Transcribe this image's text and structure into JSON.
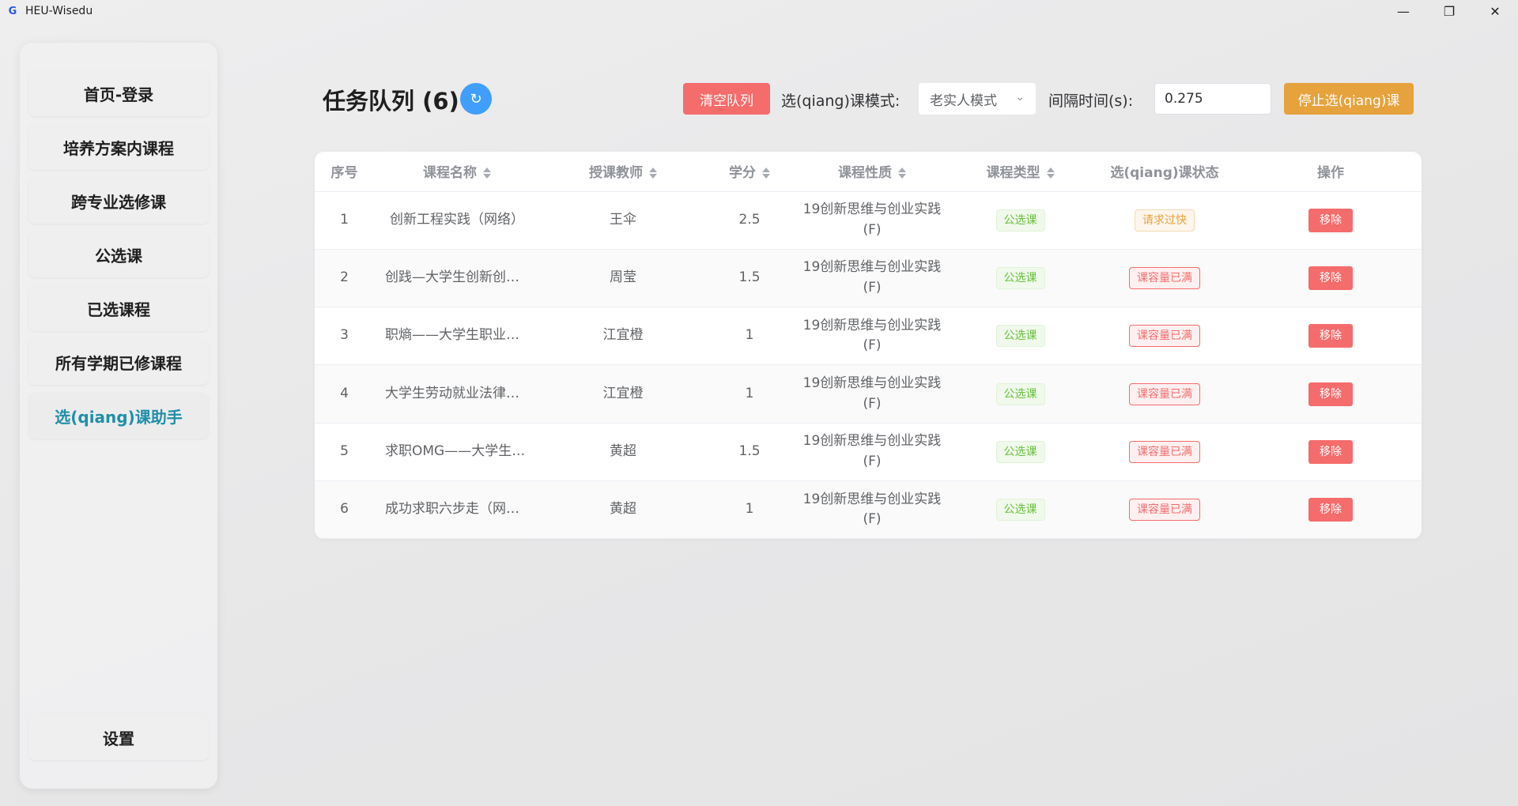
{
  "titlebar": {
    "logo": "G",
    "title": "HEU-Wisedu",
    "minimize": "—",
    "restore": "❐",
    "close": "✕"
  },
  "sidebar": {
    "items": [
      {
        "label": "首页-登录"
      },
      {
        "label": "培养方案内课程"
      },
      {
        "label": "跨专业选修课"
      },
      {
        "label": "公选课"
      },
      {
        "label": "已选课程"
      },
      {
        "label": "所有学期已修课程"
      },
      {
        "label": "选(qiang)课助手"
      }
    ],
    "active_index": 6,
    "settings_label": "设置"
  },
  "header": {
    "title": "任务队列 (6)",
    "refresh_icon": "↻",
    "clear_label": "清空队列",
    "mode_label": "选(qiang)课模式:",
    "mode_value": "老实人模式",
    "interval_label": "间隔时间(s):",
    "interval_value": "0.275",
    "stop_label": "停止选(qiang)课"
  },
  "table": {
    "headers": [
      "序号",
      "课程名称",
      "授课教师",
      "学分",
      "课程性质",
      "课程类型",
      "选(qiang)课状态",
      "操作"
    ],
    "rows": [
      {
        "index": "1",
        "name": "创新工程实践（网络）",
        "teacher": "王伞",
        "credit": "2.5",
        "nature_line1": "19创新思维与创业实践",
        "nature_line2": "(F)",
        "type": "公选课",
        "status": "请求过快",
        "status_kind": "warning",
        "action": "移除"
      },
      {
        "index": "2",
        "name": "创践—大学生创新创业实务（...",
        "teacher": "周莹",
        "credit": "1.5",
        "nature_line1": "19创新思维与创业实践",
        "nature_line2": "(F)",
        "type": "公选课",
        "status": "课容量已满",
        "status_kind": "danger",
        "action": "移除"
      },
      {
        "index": "3",
        "name": "职熵——大学生职业素质与能...",
        "teacher": "江宜橙",
        "credit": "1",
        "nature_line1": "19创新思维与创业实践",
        "nature_line2": "(F)",
        "type": "公选课",
        "status": "课容量已满",
        "status_kind": "danger",
        "action": "移除"
      },
      {
        "index": "4",
        "name": "大学生劳动就业法律问题解读...",
        "teacher": "江宜橙",
        "credit": "1",
        "nature_line1": "19创新思维与创业实践",
        "nature_line2": "(F)",
        "type": "公选课",
        "status": "课容量已满",
        "status_kind": "danger",
        "action": "移除"
      },
      {
        "index": "5",
        "name": "求职OMG——大学生就业指导...",
        "teacher": "黄超",
        "credit": "1.5",
        "nature_line1": "19创新思维与创业实践",
        "nature_line2": "(F)",
        "type": "公选课",
        "status": "课容量已满",
        "status_kind": "danger",
        "action": "移除"
      },
      {
        "index": "6",
        "name": "成功求职六步走（网络）",
        "teacher": "黄超",
        "credit": "1",
        "nature_line1": "19创新思维与创业实践",
        "nature_line2": "(F)",
        "type": "公选课",
        "status": "课容量已满",
        "status_kind": "danger",
        "action": "移除"
      }
    ]
  },
  "colors": {
    "primary": "#409eff",
    "danger": "#f56c6c",
    "warning": "#e6a23c",
    "success": "#67c23a",
    "active_nav": "#1f8fa8"
  }
}
